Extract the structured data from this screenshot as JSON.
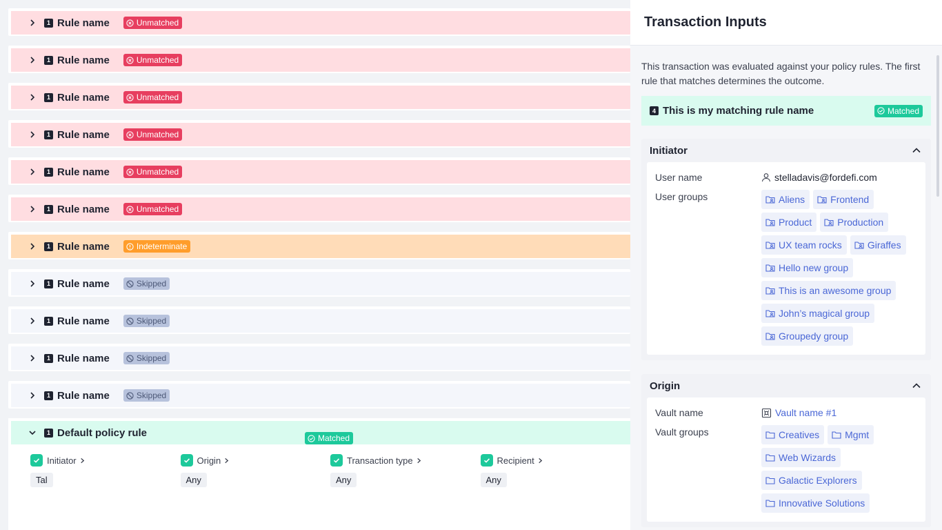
{
  "rules": [
    {
      "number": "1",
      "name": "Rule name",
      "status": "unmatched",
      "badge": "Unmatched"
    },
    {
      "number": "1",
      "name": "Rule name",
      "status": "unmatched",
      "badge": "Unmatched"
    },
    {
      "number": "1",
      "name": "Rule name",
      "status": "unmatched",
      "badge": "Unmatched"
    },
    {
      "number": "1",
      "name": "Rule name",
      "status": "unmatched",
      "badge": "Unmatched"
    },
    {
      "number": "1",
      "name": "Rule name",
      "status": "unmatched",
      "badge": "Unmatched"
    },
    {
      "number": "1",
      "name": "Rule name",
      "status": "unmatched",
      "badge": "Unmatched"
    },
    {
      "number": "1",
      "name": "Rule name",
      "status": "indeterminate",
      "badge": "Indeterminate"
    },
    {
      "number": "1",
      "name": "Rule name",
      "status": "skipped",
      "badge": "Skipped"
    },
    {
      "number": "1",
      "name": "Rule name",
      "status": "skipped",
      "badge": "Skipped"
    },
    {
      "number": "1",
      "name": "Rule name",
      "status": "skipped",
      "badge": "Skipped"
    },
    {
      "number": "1",
      "name": "Rule name",
      "status": "skipped",
      "badge": "Skipped"
    }
  ],
  "default_rule": {
    "number": "1",
    "name": "Default policy rule",
    "badge": "Matched",
    "criteria": [
      {
        "label": "Initiator",
        "value": "Tal"
      },
      {
        "label": "Origin",
        "value": "Any"
      },
      {
        "label": "Transaction type",
        "value": "Any"
      },
      {
        "label": "Recipient",
        "value": "Any"
      }
    ]
  },
  "panel": {
    "title": "Transaction Inputs",
    "intro": "This transaction was evaluated against your policy rules. The first rule that matches determines the outcome.",
    "matching_rule": {
      "number": "4",
      "name": "This is my matching rule name",
      "badge": "Matched"
    },
    "initiator": {
      "title": "Initiator",
      "user_name_label": "User name",
      "user_name": "stelladavis@fordefi.com",
      "user_groups_label": "User groups",
      "user_groups": [
        "Aliens",
        "Frontend",
        "Product",
        "Production",
        "UX team rocks",
        "Giraffes",
        "Hello new group",
        "This is an awesome group",
        "John’s magical group",
        "Groupedy group"
      ]
    },
    "origin": {
      "title": "Origin",
      "vault_name_label": "Vault name",
      "vault_name": "Vault name #1",
      "vault_groups_label": "Vault groups",
      "vault_groups": [
        "Creatives",
        "Mgmt",
        "Web Wizards",
        "Galactic Explorers",
        "Innovative Solutions"
      ]
    }
  },
  "icons": {
    "expand": "chevron-right-icon",
    "collapse": "chevron-down-icon",
    "unmatched": "x-circle-icon",
    "indeterminate": "alert-circle-icon",
    "skipped": "ban-icon",
    "matched": "check-circle-icon",
    "user": "user-icon",
    "user_group": "user-group-folder-icon",
    "vault": "vault-icon",
    "vault_group": "folder-icon",
    "section_collapse": "chevron-up-icon"
  },
  "colors": {
    "unmatched": "#e73e5f",
    "indeterminate": "#ff9d2b",
    "skipped": "#b7c2dc",
    "matched": "#1dc99b",
    "link": "#4a67d6"
  }
}
